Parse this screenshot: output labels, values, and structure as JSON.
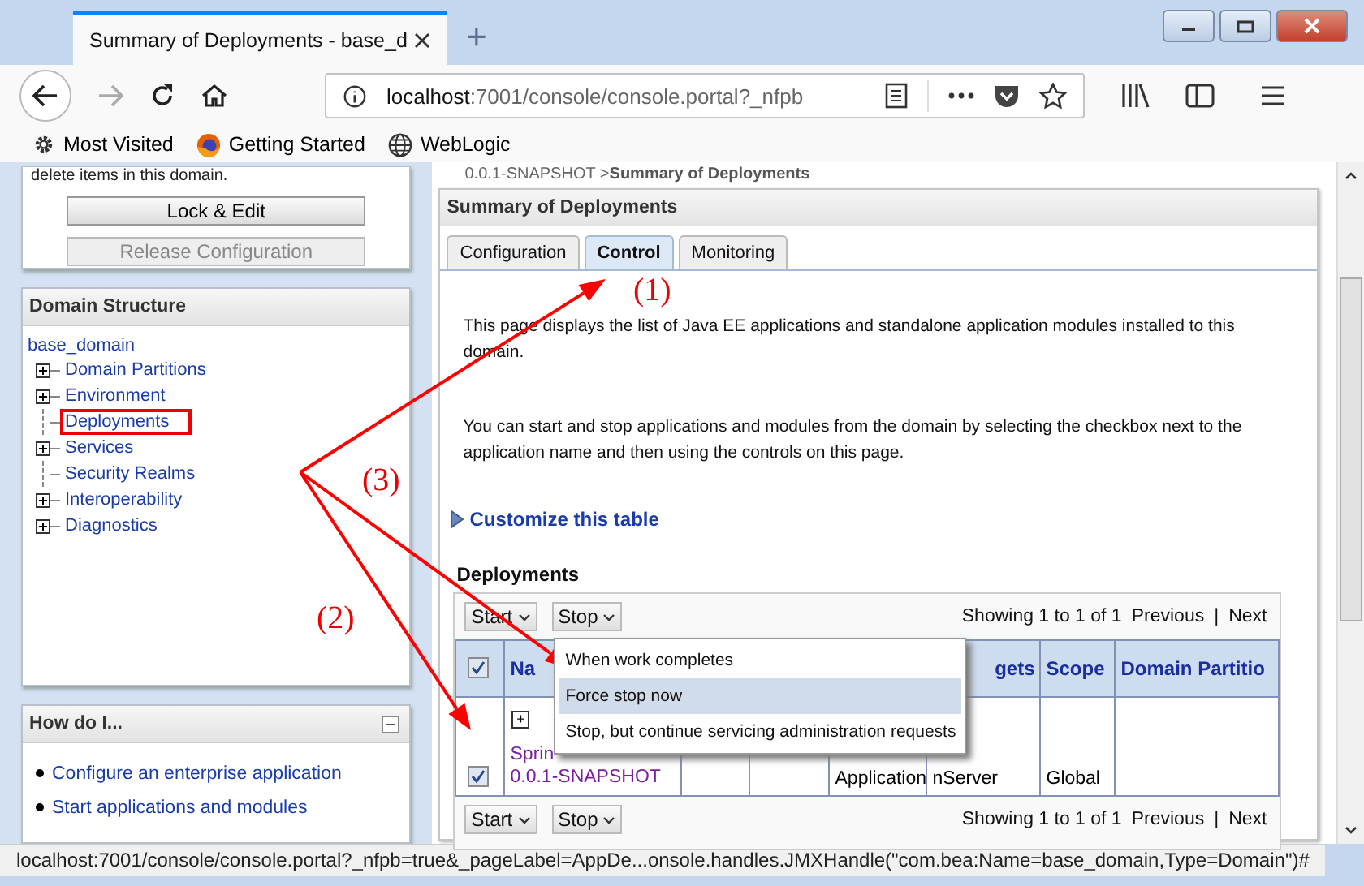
{
  "browser": {
    "tab_title": "Summary of Deployments - base_d",
    "new_tab": "+",
    "url_host": "localhost",
    "url_rest": ":7001/console/console.portal?_nfpb",
    "bookmarks": [
      {
        "label": "Most Visited",
        "kind": "gear"
      },
      {
        "label": "Getting Started",
        "kind": "firefox"
      },
      {
        "label": "WebLogic",
        "kind": "globe"
      }
    ]
  },
  "change_center": {
    "text": "delete items in this domain.",
    "buttons": [
      {
        "label": "Lock & Edit",
        "disabled": false
      },
      {
        "label": "Release Configuration",
        "disabled": true
      }
    ]
  },
  "domain_structure": {
    "title": "Domain Structure",
    "root": "base_domain",
    "children": [
      {
        "label": "Domain Partitions",
        "expandable": true,
        "boxed": false
      },
      {
        "label": "Environment",
        "expandable": true,
        "boxed": false
      },
      {
        "label": "Deployments",
        "expandable": false,
        "boxed": true
      },
      {
        "label": "Services",
        "expandable": true,
        "boxed": false
      },
      {
        "label": "Security Realms",
        "expandable": false,
        "boxed": false
      },
      {
        "label": "Interoperability",
        "expandable": true,
        "boxed": false
      },
      {
        "label": "Diagnostics",
        "expandable": true,
        "boxed": false
      }
    ]
  },
  "how_do_i": {
    "title": "How do I...",
    "links": [
      "Configure an enterprise application",
      "Start applications and modules"
    ]
  },
  "breadcrumb": {
    "trail": "0.0.1-SNAPSHOT >",
    "current": "Summary of Deployments"
  },
  "panel": {
    "title": "Summary of Deployments",
    "tabs": [
      {
        "label": "Configuration",
        "selected": false
      },
      {
        "label": "Control",
        "selected": true
      },
      {
        "label": "Monitoring",
        "selected": false
      }
    ],
    "paragraphs": [
      "This page displays the list of Java EE applications and standalone application modules installed to this domain.",
      "You can start and stop applications and modules from the domain by selecting the checkbox next to the application name and then using the controls on this page."
    ],
    "customize": "Customize this table",
    "table_title": "Deployments",
    "toolbars": [
      {
        "buttons": [
          "Start",
          "Stop"
        ],
        "showing": "Showing 1 to 1 of 1",
        "previous": "Previous",
        "separator": "|",
        "next": "Next"
      },
      {
        "buttons": [
          "Start",
          "Stop"
        ],
        "showing": "Showing 1 to 1 of 1",
        "previous": "Previous",
        "separator": "|",
        "next": "Next"
      }
    ],
    "all_checked": true,
    "columns": [
      "Na",
      "",
      "",
      "",
      "gets",
      "Scope",
      "Domain Partitio"
    ],
    "rows": [
      {
        "checked": true,
        "cells": [
          {
            "expand": "+",
            "lines": [
              "Sprin",
              "0.0.1-SNAPSHOT"
            ]
          },
          "",
          "",
          "Application",
          "nServer",
          "Global",
          ""
        ]
      }
    ]
  },
  "stop_menu": {
    "items": [
      {
        "label": "When work completes",
        "selected": false
      },
      {
        "label": "Force stop now",
        "selected": true
      },
      {
        "label": "Stop, but continue servicing administration requests",
        "selected": false
      }
    ]
  },
  "status_bar": "localhost:7001/console/console.portal?_nfpb=true&_pageLabel=AppDe...onsole.handles.JMXHandle(\"com.bea:Name=base_domain,Type=Domain\")#",
  "annotations": {
    "labels": [
      "(1)",
      "(2)",
      "(3)"
    ]
  }
}
